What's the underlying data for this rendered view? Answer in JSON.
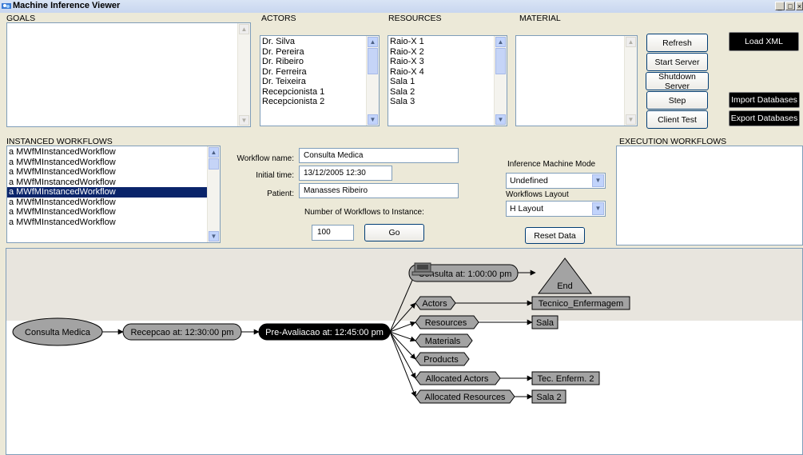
{
  "window": {
    "title": "Machine Inference Viewer"
  },
  "goals": {
    "label": "GOALS",
    "items": []
  },
  "actors": {
    "label": "ACTORS",
    "items": [
      "Dr. Silva",
      "Dr. Pereira",
      "Dr. Ribeiro",
      "Dr. Ferreira",
      "Dr. Teixeira",
      "Recepcionista 1",
      "Recepcionista 2"
    ]
  },
  "resources": {
    "label": "RESOURCES",
    "items": [
      "Raio-X 1",
      "Raio-X 2",
      "Raio-X 3",
      "Raio-X 4",
      "Sala 1",
      "Sala 2",
      "Sala 3"
    ]
  },
  "material": {
    "label": "MATERIAL",
    "items": []
  },
  "buttons": {
    "refresh": "Refresh",
    "start_server": "Start Server",
    "shutdown_server": "Shutdown Server",
    "step": "Step",
    "client_test": "Client Test",
    "load_xml": "Load XML",
    "import_db": "Import Databases",
    "export_db": "Export Databases",
    "go": "Go",
    "reset_data": "Reset Data"
  },
  "instanced": {
    "label": "INSTANCED WORKFLOWS",
    "items": [
      "a MWfMInstancedWorkflow",
      "a MWfMInstancedWorkflow",
      "a MWfMInstancedWorkflow",
      "a MWfMInstancedWorkflow",
      "a MWfMInstancedWorkflow",
      "a MWfMInstancedWorkflow",
      "a MWfMInstancedWorkflow",
      "a MWfMInstancedWorkflow"
    ],
    "selected_index": 4
  },
  "form": {
    "workflow_name_label": "Workflow name:",
    "workflow_name": "Consulta Medica",
    "initial_time_label": "Initial time:",
    "initial_time": "13/12/2005 12:30",
    "patient_label": "Patient:",
    "patient": "Manasses Ribeiro",
    "count_label": "Number of Workflows to Instance:",
    "count": "100"
  },
  "inference": {
    "mode_label": "Inference Machine Mode",
    "mode_value": "Undefined",
    "layout_label": "Workflows Layout",
    "layout_value": "H Layout"
  },
  "execution": {
    "label": "EXECUTION WORKFLOWS",
    "items": []
  },
  "graph": {
    "start": "Consulta Medica",
    "recepcao": "Recepcao at: 12:30:00 pm",
    "pre": "Pre-Avaliacao at: 12:45:00 pm",
    "consulta": "Consulta at: 1:00:00 pm",
    "end": "End",
    "actors": "Actors",
    "resources": "Resources",
    "materials": "Materials",
    "products": "Products",
    "alloc_actors": "Allocated Actors",
    "alloc_resources": "Allocated Resources",
    "tecnico": "Tecnico_Enfermagem",
    "sala": "Sala",
    "tec_enferm": "Tec. Enferm. 2",
    "sala2": "Sala 2"
  }
}
